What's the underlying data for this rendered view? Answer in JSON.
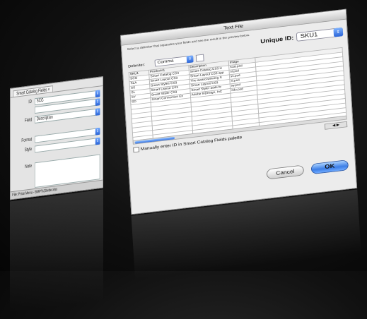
{
  "palette": {
    "tab_label": "Smart Catalog Fields",
    "rows": [
      {
        "label": "ID",
        "value": "SCG"
      },
      {
        "label": "",
        "value": ""
      },
      {
        "label": "Field",
        "value": "Description"
      },
      {
        "label": "Format",
        "value": ""
      },
      {
        "label": "Style",
        "value": ""
      }
    ],
    "note_label": "Note",
    "footer": "File: Price Menu - BMP%20wbe.xlsx"
  },
  "dialog": {
    "title": "Text File",
    "instruction": "Select a delimiter that separates your fields and see the result in the preview below.",
    "unique_id_label": "Unique ID:",
    "unique_id_value": "SKU1",
    "delimiter_label": "Delimiter:",
    "delimiter_value": "Comma",
    "table": {
      "headers": [
        "SKU1",
        "Products1",
        "Description",
        "Image"
      ],
      "rows": [
        [
          "SCG",
          "Smart Catalog CS3",
          "Smart Catalog CS3 is",
          "scat.psd"
        ],
        [
          "SLA",
          "Smart Layout CS3",
          "Smart Layout CS3 app",
          "sl.psd"
        ],
        [
          "SS",
          "Smart Styles CS3",
          "The award-winning S",
          "ss.psd"
        ],
        [
          "SL",
          "Smart Layout CS3",
          "Smart Layout CS3",
          "sl.psd"
        ],
        [
          "SY",
          "Smart Styler CS3",
          "Smart Styler adds fe",
          "sy.psd"
        ],
        [
          "SD",
          "Smart Connection En",
          "Adobe InDesign, InC",
          "sdo.psd"
        ]
      ],
      "empty_rows": 8
    },
    "checkbox_label": "Manually enter ID in Smart Catalog Fields palette",
    "cancel_label": "Cancel",
    "ok_label": "OK"
  },
  "colors": {
    "accent": "#3c7ee6",
    "background": "#111111"
  }
}
